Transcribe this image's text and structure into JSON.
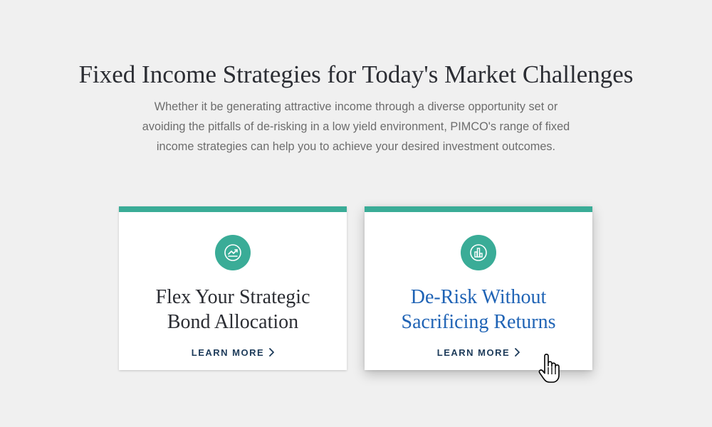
{
  "header": {
    "title": "Fixed Income Strategies for Today's Market Challenges",
    "intro_lines": [
      "Whether it be generating attractive income through a diverse opportunity set or",
      "avoiding the pitfalls of de-risking in a low yield environment, PIMCO's range of fixed",
      "income strategies can help you to achieve your desired investment outcomes."
    ]
  },
  "cards": [
    {
      "icon": "trend-up-chart-icon",
      "title_lines": [
        "Flex Your Strategic",
        "Bond Allocation"
      ],
      "link_label": "LEARN MORE"
    },
    {
      "icon": "bar-chart-icon",
      "title_lines": [
        "De-Risk Without",
        "Sacrificing Returns"
      ],
      "link_label": "LEARN MORE"
    }
  ],
  "colors": {
    "background": "#f0f0f0",
    "accent_teal": "#3aac97",
    "title_dark": "#2b2d33",
    "hover_title_blue": "#1f63b5",
    "link_navy": "#1d3b5a"
  }
}
